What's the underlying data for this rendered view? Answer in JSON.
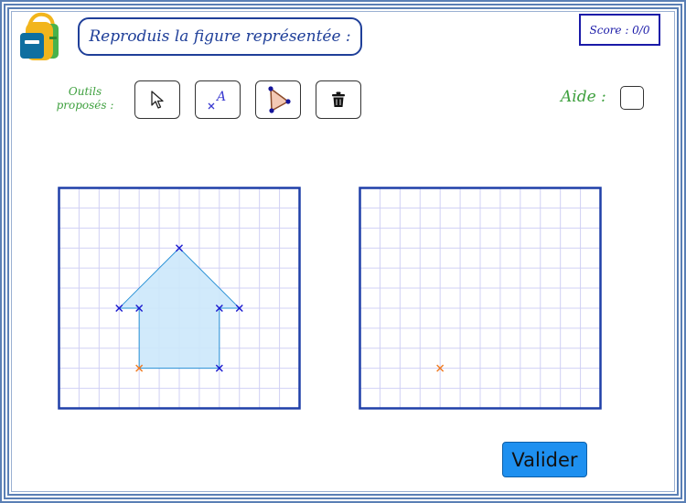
{
  "header": {
    "title": "Reproduis la figure représentée :",
    "score": "Score : 0/0"
  },
  "toolbar": {
    "label": "Outils proposés :",
    "tools": [
      {
        "name": "select",
        "icon": "cursor-arrow-icon"
      },
      {
        "name": "point",
        "icon": "point-A-icon",
        "glyph": "A"
      },
      {
        "name": "polygon",
        "icon": "polygon-triangle-icon"
      },
      {
        "name": "delete",
        "icon": "trash-icon"
      }
    ]
  },
  "help": {
    "label": "Aide :",
    "checked": false
  },
  "colors": {
    "frame": "#5a7fb5",
    "title": "#1f3f99",
    "accent_green": "#3ea03e",
    "grid_line": "#d0d0f4",
    "grid_border": "#1f3fa8",
    "shape_fill": "#cce8fb",
    "shape_stroke": "#2a92d6",
    "point_blue": "#1a1ad0",
    "point_orange": "#f07a20",
    "button": "#1e90f0"
  },
  "model_grid": {
    "columns": 12,
    "rows": 11,
    "polygon": [
      [
        6,
        3
      ],
      [
        9,
        6
      ],
      [
        8,
        6
      ],
      [
        8,
        9
      ],
      [
        4,
        9
      ],
      [
        4,
        6
      ],
      [
        3,
        6
      ]
    ],
    "points": [
      {
        "x": 6,
        "y": 3,
        "color": "blue"
      },
      {
        "x": 3,
        "y": 6,
        "color": "blue"
      },
      {
        "x": 4,
        "y": 6,
        "color": "blue"
      },
      {
        "x": 8,
        "y": 6,
        "color": "blue"
      },
      {
        "x": 9,
        "y": 6,
        "color": "blue"
      },
      {
        "x": 8,
        "y": 9,
        "color": "blue"
      },
      {
        "x": 4,
        "y": 9,
        "color": "orange"
      }
    ]
  },
  "answer_grid": {
    "columns": 12,
    "rows": 11,
    "points": [
      {
        "x": 4,
        "y": 9,
        "color": "orange"
      }
    ]
  },
  "actions": {
    "validate": "Valider"
  }
}
